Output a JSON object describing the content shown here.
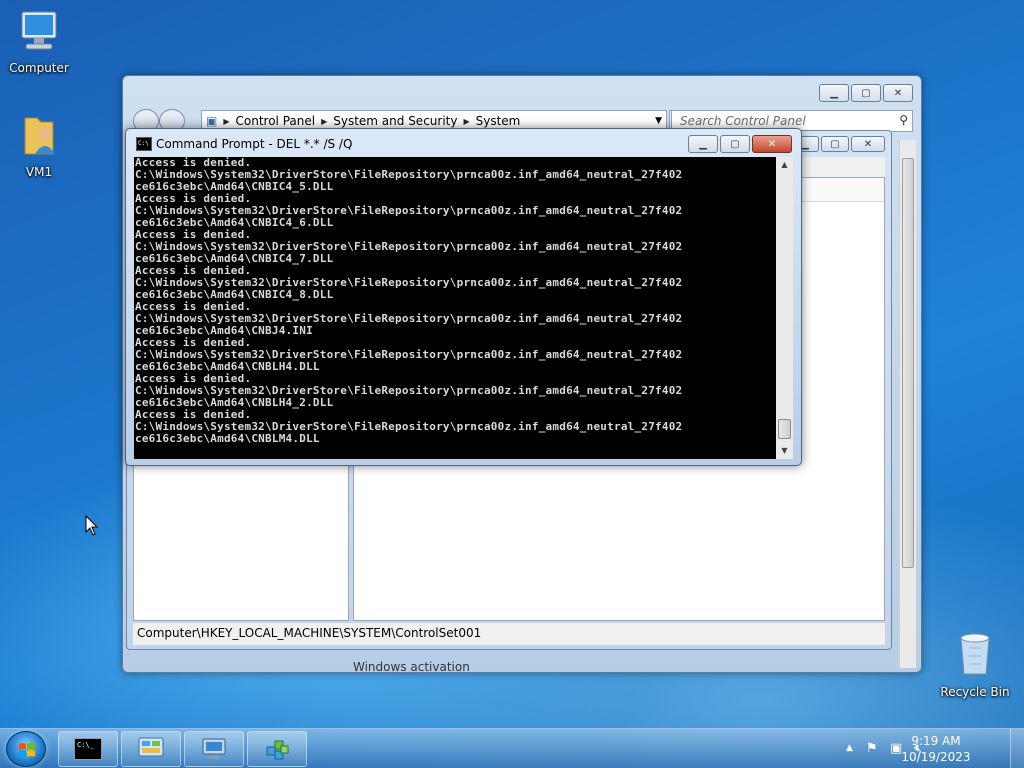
{
  "desktop": {
    "icons": [
      {
        "label": "Computer"
      },
      {
        "label": "VM1"
      },
      {
        "label": "Recycle Bin"
      }
    ]
  },
  "control_panel": {
    "breadcrumb": [
      "Control Panel",
      "System and Security",
      "System"
    ],
    "search_placeholder": "Search Control Panel",
    "behind_text": "Windows activation"
  },
  "registry": {
    "status": "Computer\\HKEY_LOCAL_MACHINE\\SYSTEM\\ControlSet001"
  },
  "cmd": {
    "title": "Command Prompt - DEL  *.* /S /Q",
    "lines": [
      "Access is denied.",
      "C:\\Windows\\System32\\DriverStore\\FileRepository\\prnca00z.inf_amd64_neutral_27f402",
      "ce616c3ebc\\Amd64\\CNBIC4_5.DLL",
      "Access is denied.",
      "C:\\Windows\\System32\\DriverStore\\FileRepository\\prnca00z.inf_amd64_neutral_27f402",
      "ce616c3ebc\\Amd64\\CNBIC4_6.DLL",
      "Access is denied.",
      "C:\\Windows\\System32\\DriverStore\\FileRepository\\prnca00z.inf_amd64_neutral_27f402",
      "ce616c3ebc\\Amd64\\CNBIC4_7.DLL",
      "Access is denied.",
      "C:\\Windows\\System32\\DriverStore\\FileRepository\\prnca00z.inf_amd64_neutral_27f402",
      "ce616c3ebc\\Amd64\\CNBIC4_8.DLL",
      "Access is denied.",
      "C:\\Windows\\System32\\DriverStore\\FileRepository\\prnca00z.inf_amd64_neutral_27f402",
      "ce616c3ebc\\Amd64\\CNBJ4.INI",
      "Access is denied.",
      "C:\\Windows\\System32\\DriverStore\\FileRepository\\prnca00z.inf_amd64_neutral_27f402",
      "ce616c3ebc\\Amd64\\CNBLH4.DLL",
      "Access is denied.",
      "C:\\Windows\\System32\\DriverStore\\FileRepository\\prnca00z.inf_amd64_neutral_27f402",
      "ce616c3ebc\\Amd64\\CNBLH4_2.DLL",
      "Access is denied.",
      "C:\\Windows\\System32\\DriverStore\\FileRepository\\prnca00z.inf_amd64_neutral_27f402",
      "ce616c3ebc\\Amd64\\CNBLM4.DLL"
    ]
  },
  "taskbar": {
    "time": "9:19 AM",
    "date": "10/19/2023",
    "items": [
      "command-prompt-icon",
      "control-panel-icon",
      "remote-desktop-icon",
      "registry-editor-icon"
    ]
  },
  "colors": {
    "console_bg": "#000000",
    "console_fg": "#d9d9d9",
    "close_button": "#c7452c"
  }
}
